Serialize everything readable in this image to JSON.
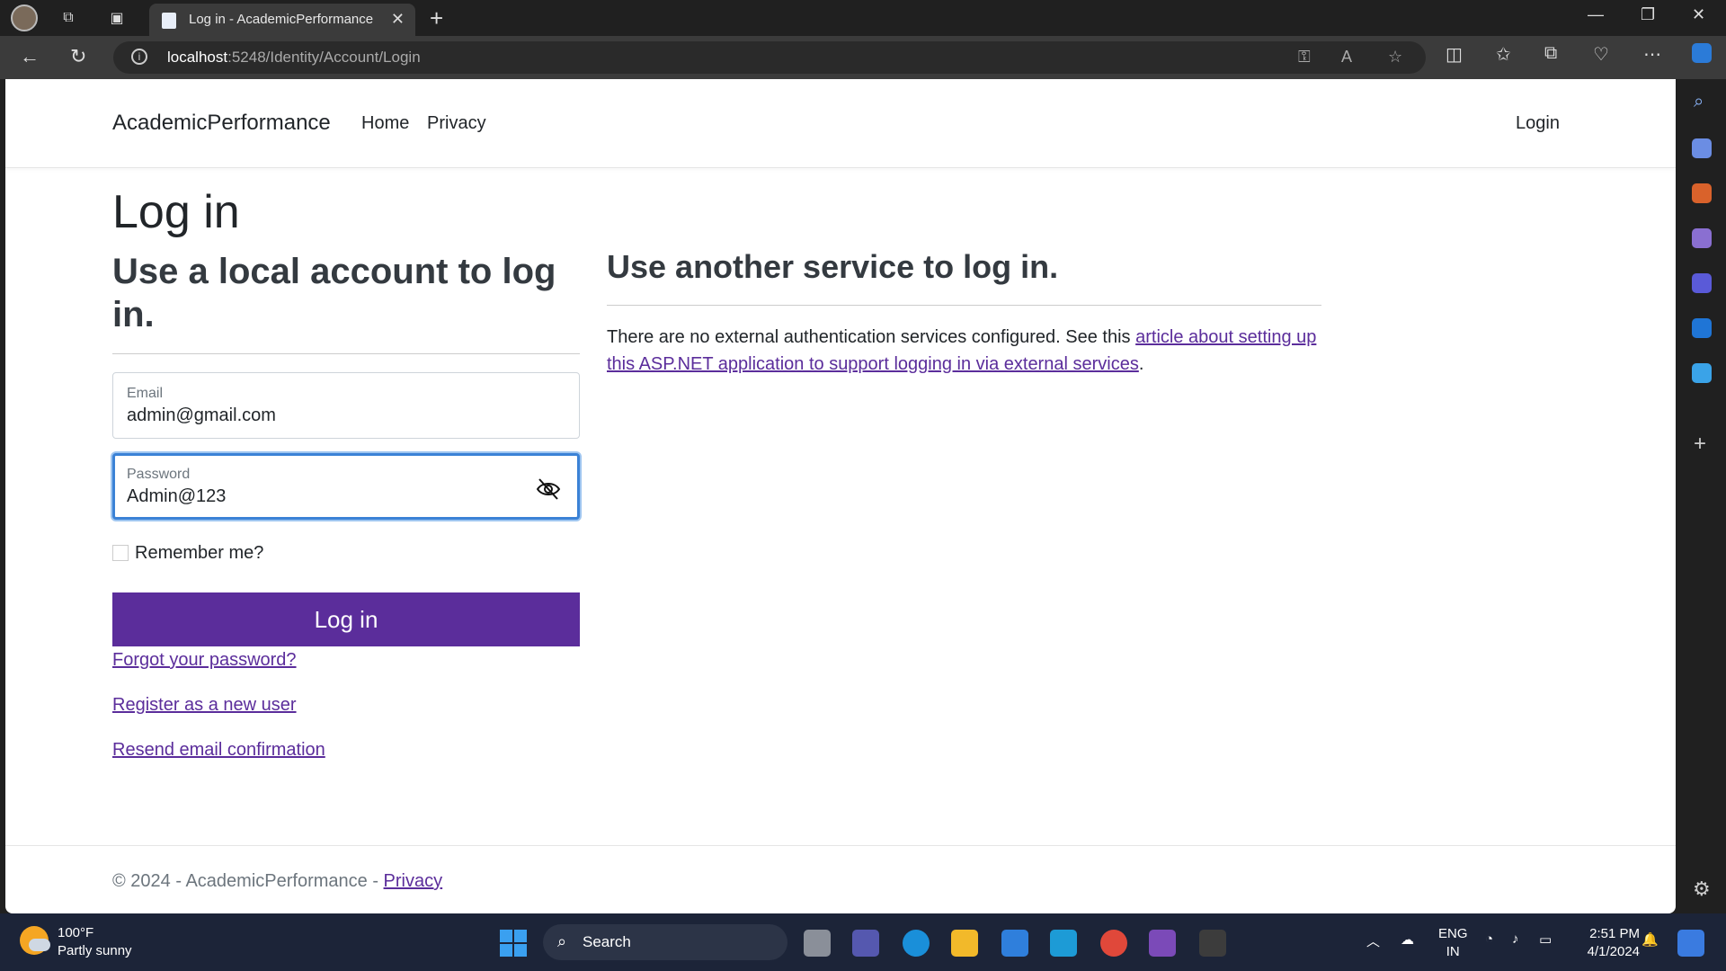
{
  "browser": {
    "tab_title": "Log in - AcademicPerformance",
    "url_host": "localhost",
    "url_path": ":5248/Identity/Account/Login"
  },
  "site": {
    "brand": "AcademicPerformance",
    "nav": [
      "Home",
      "Privacy"
    ],
    "login_link": "Login"
  },
  "login": {
    "title": "Log in",
    "local_heading": "Use a local account to log in.",
    "email_label": "Email",
    "email_value": "admin@gmail.com",
    "password_label": "Password",
    "password_value": "Admin@123",
    "remember_label": "Remember me?",
    "submit_label": "Log in",
    "forgot_link": "Forgot your password?",
    "register_link": "Register as a new user",
    "resend_link": "Resend email confirmation"
  },
  "external": {
    "heading": "Use another service to log in.",
    "text_before": "There are no external authentication services configured. See this ",
    "link_text": "article about setting up this ASP.NET application to support logging in via external services",
    "text_after": "."
  },
  "footer": {
    "copyright": "© 2024 - AcademicPerformance - ",
    "privacy_link": "Privacy"
  },
  "taskbar": {
    "temperature": "100°F",
    "weather": "Partly sunny",
    "search_label": "Search",
    "lang_line1": "ENG",
    "lang_line2": "IN",
    "time": "2:51 PM",
    "date": "4/1/2024"
  },
  "colors": {
    "accent": "#5b2d9b",
    "focus_border": "#3b82d6",
    "taskbar": "#1c2438"
  }
}
